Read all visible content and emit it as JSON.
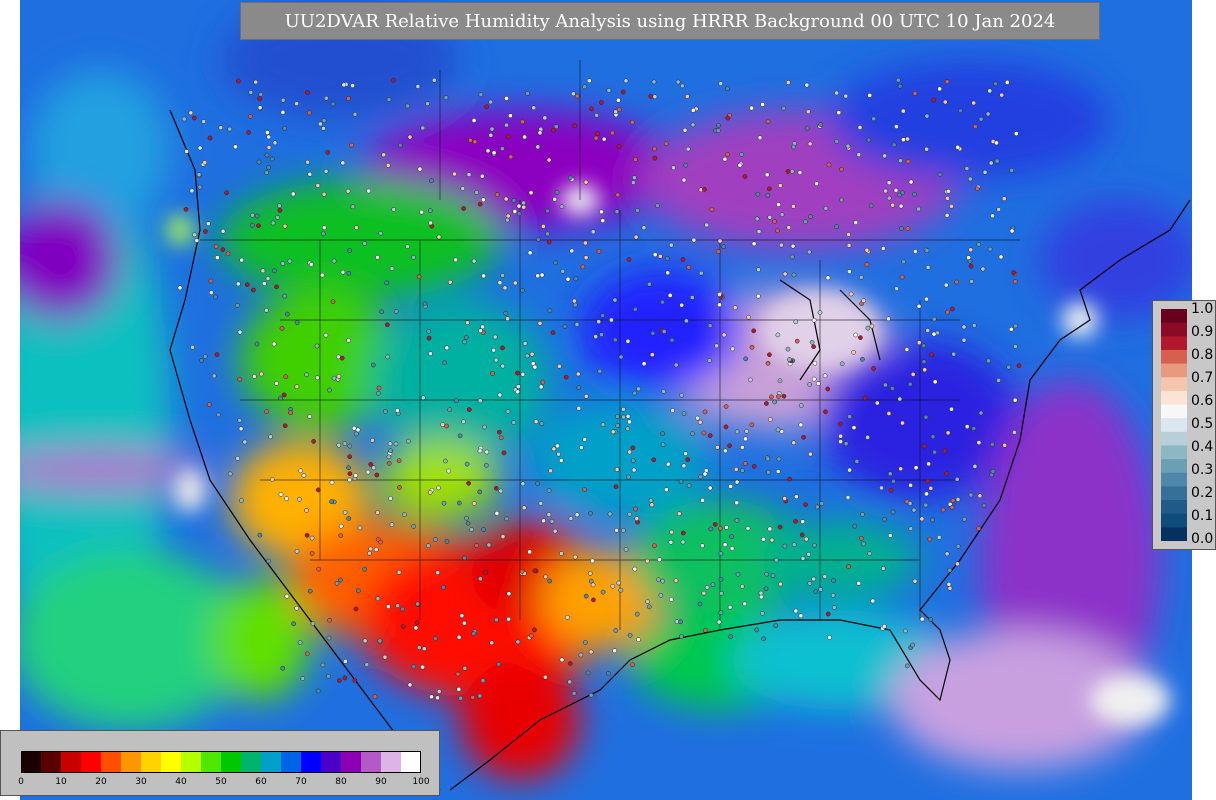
{
  "title": "UU2DVAR Relative Humidity Analysis using HRRR Background 00 UTC 10 Jan 2024",
  "legend_obs": {
    "ticks": [
      "1.0",
      "0.9",
      "0.8",
      "0.7",
      "0.6",
      "0.5",
      "0.4",
      "0.3",
      "0.2",
      "0.1",
      "0.0"
    ],
    "colors": [
      "#67001f",
      "#8b0a26",
      "#b2182b",
      "#d6604d",
      "#e89a7f",
      "#f4c6ae",
      "#fbe3d6",
      "#f7f7f7",
      "#dbe6ee",
      "#b6cfd9",
      "#8cb8c4",
      "#6a9fb4",
      "#4d87a9",
      "#35709a",
      "#1f5a8a",
      "#0f4b7b",
      "#053061"
    ]
  },
  "colorbar": {
    "ticks": [
      "0",
      "10",
      "20",
      "30",
      "40",
      "50",
      "60",
      "70",
      "80",
      "90",
      "100"
    ],
    "colors": [
      "#1a0000",
      "#5a0000",
      "#c80000",
      "#ff0000",
      "#ff5000",
      "#ff9600",
      "#ffd200",
      "#ffff00",
      "#b4ff00",
      "#50e600",
      "#00c800",
      "#00b46e",
      "#00a0c8",
      "#0064e6",
      "#0000ff",
      "#4b00c8",
      "#8c00b4",
      "#b45ac8",
      "#dcb4e6",
      "#ffffff"
    ]
  }
}
